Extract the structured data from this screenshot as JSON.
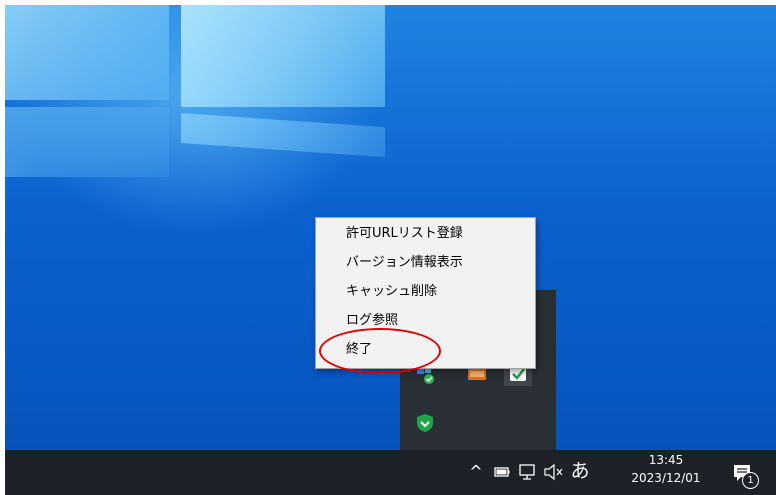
{
  "context_menu": {
    "items": [
      {
        "label": "許可URLリスト登録"
      },
      {
        "label": "バージョン情報表示"
      },
      {
        "label": "キャッシュ削除"
      },
      {
        "label": "ログ参照"
      },
      {
        "label": "終了"
      }
    ]
  },
  "overflow_icons": [
    {
      "icon": "security-app-icon"
    },
    {
      "icon": "orange-app-icon"
    },
    {
      "icon": "checkmark-app-icon"
    },
    {
      "icon": "shield-icon"
    }
  ],
  "taskbar": {
    "tray_chevron_glyph": "^",
    "ime_mode": "あ",
    "time": "13:45",
    "date": "2023/12/01",
    "notification_count": "1"
  },
  "colors": {
    "desktop_blue": "#0b62cf",
    "taskbar": "#1d2228",
    "menu_bg": "#f2f2f2",
    "highlight_red": "#e00000"
  }
}
